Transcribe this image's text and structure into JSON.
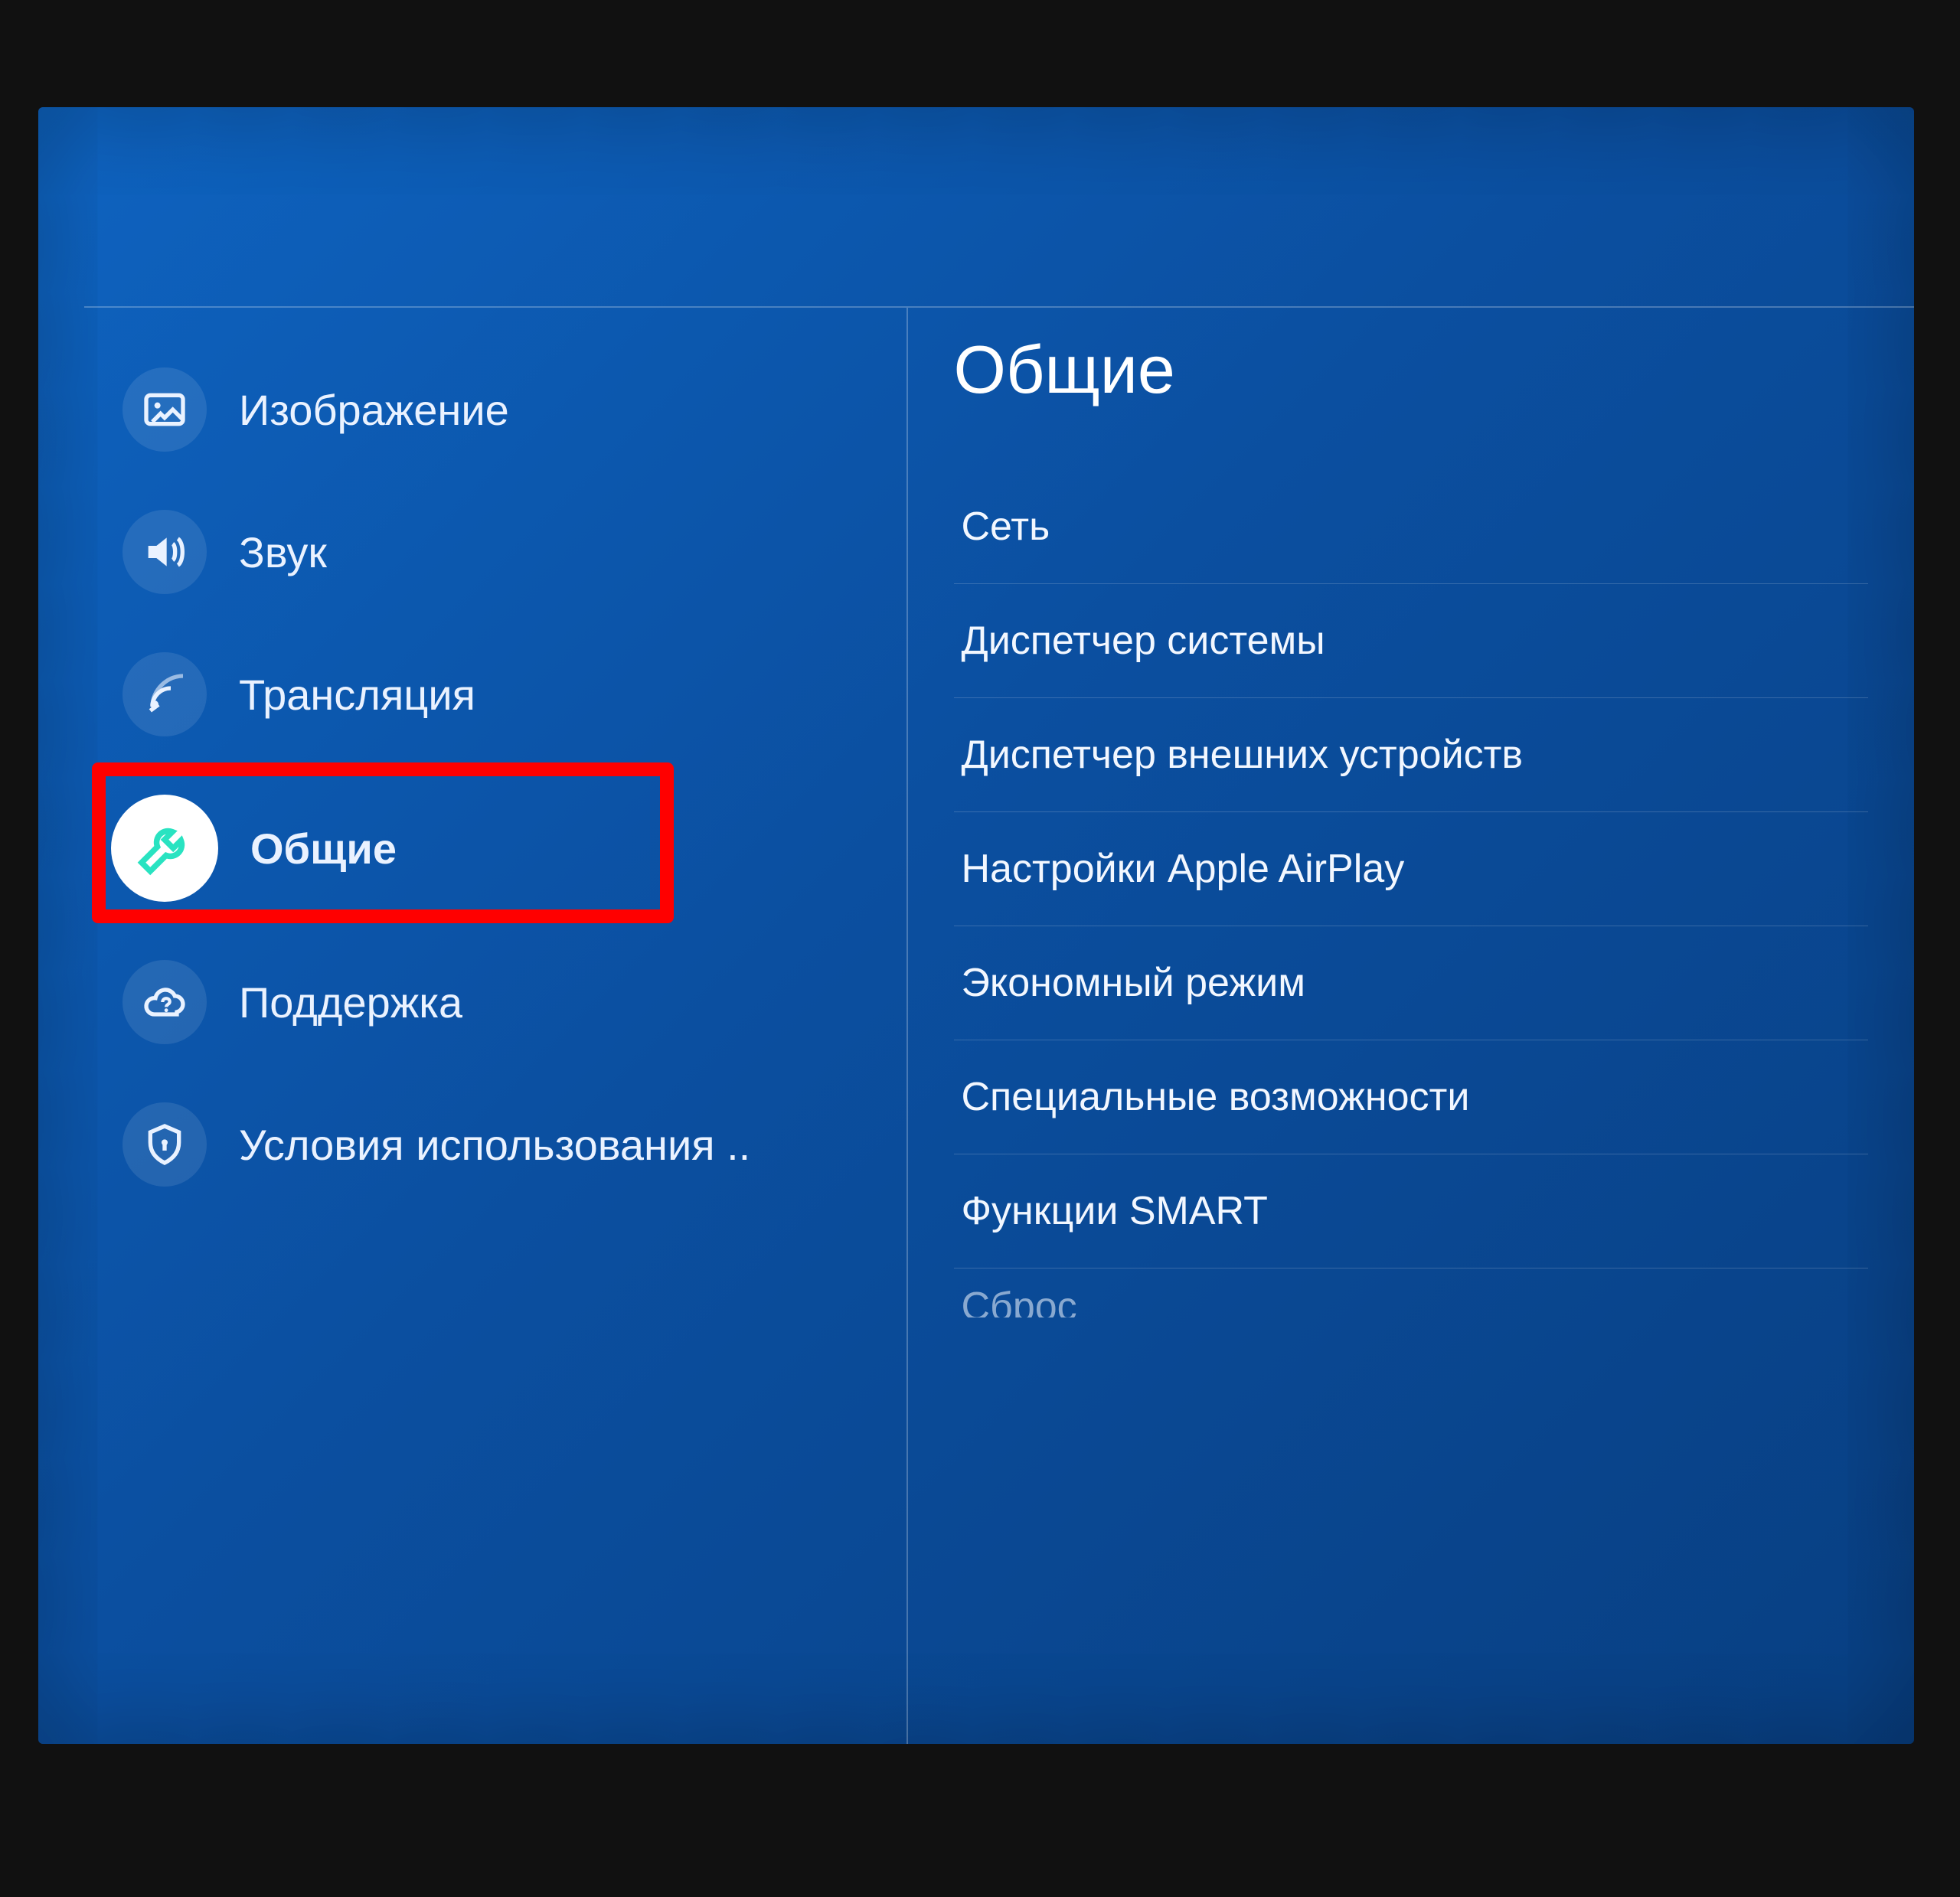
{
  "colors": {
    "accent_icon": "#29e3c1",
    "highlight": "#ff0000"
  },
  "sidebar": {
    "items": [
      {
        "id": "picture",
        "label": "Изображение",
        "icon": "image-icon",
        "selected": false
      },
      {
        "id": "sound",
        "label": "Звук",
        "icon": "speaker-icon",
        "selected": false
      },
      {
        "id": "broadcast",
        "label": "Трансляция",
        "icon": "satellite-icon",
        "selected": false
      },
      {
        "id": "general",
        "label": "Общие",
        "icon": "wrench-icon",
        "selected": true
      },
      {
        "id": "support",
        "label": "Поддержка",
        "icon": "cloud-question-icon",
        "selected": false
      },
      {
        "id": "terms",
        "label": "Условия использования ..",
        "icon": "shield-icon",
        "selected": false
      }
    ]
  },
  "content": {
    "title": "Общие",
    "items": [
      "Сеть",
      "Диспетчер системы",
      "Диспетчер внешних устройств",
      "Настройки Apple AirPlay",
      "Экономный режим",
      "Специальные возможности",
      "Функции SMART",
      "Сброс"
    ]
  }
}
